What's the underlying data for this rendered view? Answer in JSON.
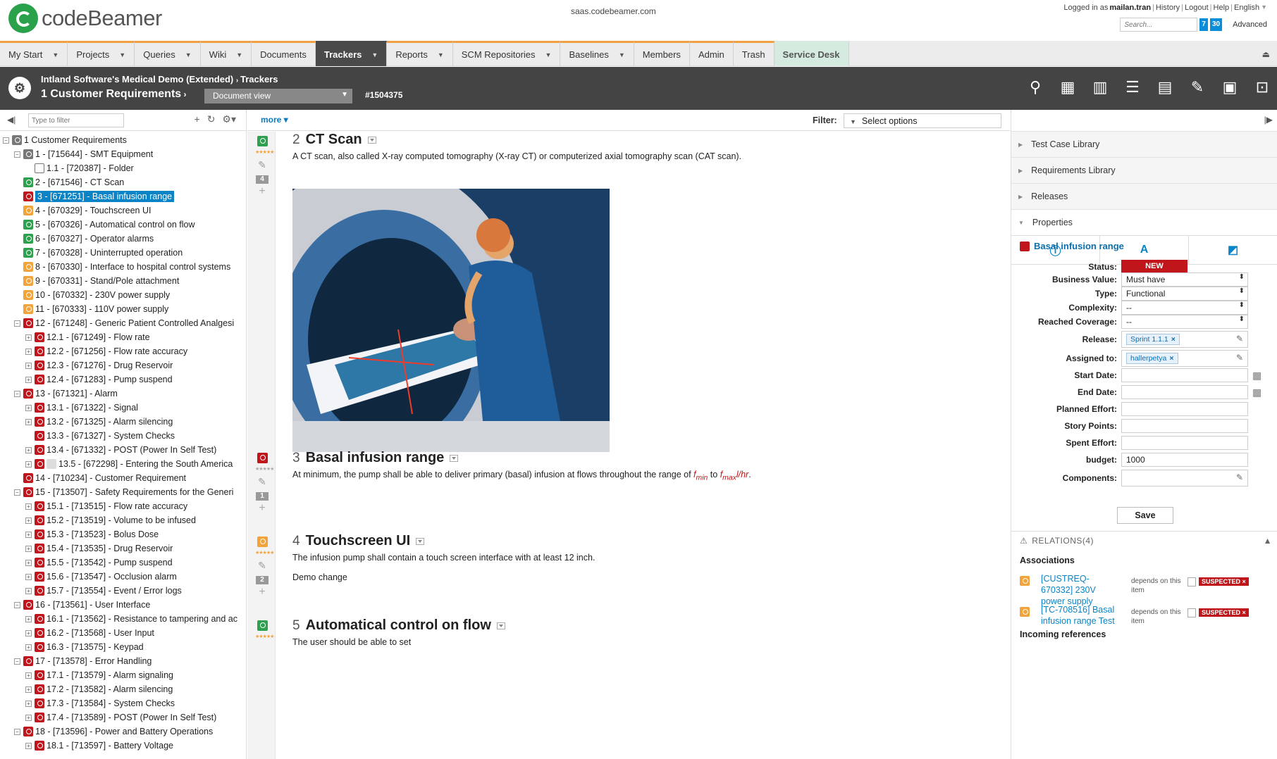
{
  "header": {
    "brand": "codeBeamer",
    "domain": "saas.codebeamer.com",
    "logged_in_prefix": "Logged in as",
    "username": "mailan.tran",
    "links": [
      "History",
      "Logout",
      "Help",
      "English"
    ],
    "search_placeholder": "Search...",
    "count_a": "7",
    "count_b": "30",
    "advanced": "Advanced"
  },
  "nav": {
    "tabs": [
      {
        "label": "My Start",
        "arrow": true
      },
      {
        "label": "Projects",
        "arrow": true
      },
      {
        "label": "Queries",
        "arrow": true
      },
      {
        "label": "Wiki",
        "arrow": true
      },
      {
        "label": "Documents",
        "arrow": false
      },
      {
        "label": "Trackers",
        "arrow": true,
        "active": true
      },
      {
        "label": "Reports",
        "arrow": true
      },
      {
        "label": "SCM Repositories",
        "arrow": true
      },
      {
        "label": "Baselines",
        "arrow": true
      },
      {
        "label": "Members",
        "arrow": false
      },
      {
        "label": "Admin",
        "arrow": false
      },
      {
        "label": "Trash",
        "arrow": false
      },
      {
        "label": "Service Desk",
        "arrow": false,
        "service": true
      }
    ]
  },
  "titlebar": {
    "project": "Intland Software's Medical Demo (Extended)",
    "section": "Trackers",
    "tracker": "1 Customer Requirements",
    "view": "Document view",
    "issue_id": "#1504375"
  },
  "left": {
    "filter_placeholder": "Type to filter",
    "tree": [
      {
        "level": 0,
        "exp": "-",
        "icon": "gray",
        "label": "1 Customer Requirements"
      },
      {
        "level": 1,
        "exp": "-",
        "icon": "gray",
        "label": "1 - [715644] - SMT Equipment"
      },
      {
        "level": 2,
        "exp": "",
        "icon": "folder",
        "label": "1.1 - [720387] - Folder"
      },
      {
        "level": 1,
        "exp": "",
        "icon": "green",
        "label": "2 - [671546] - CT Scan"
      },
      {
        "level": 1,
        "exp": "",
        "icon": "red",
        "label": "3 - [671251] - Basal infusion range",
        "selected": true
      },
      {
        "level": 1,
        "exp": "",
        "icon": "orange",
        "label": "4 - [670329] - Touchscreen UI"
      },
      {
        "level": 1,
        "exp": "",
        "icon": "green",
        "label": "5 - [670326] - Automatical control on flow"
      },
      {
        "level": 1,
        "exp": "",
        "icon": "green",
        "label": "6 - [670327] - Operator alarms"
      },
      {
        "level": 1,
        "exp": "",
        "icon": "green",
        "label": "7 - [670328] - Uninterrupted operation"
      },
      {
        "level": 1,
        "exp": "",
        "icon": "orange",
        "label": "8 - [670330] - Interface to hospital control systems"
      },
      {
        "level": 1,
        "exp": "",
        "icon": "orange",
        "label": "9 - [670331] - Stand/Pole attachment"
      },
      {
        "level": 1,
        "exp": "",
        "icon": "orange",
        "label": "10 - [670332] - 230V power supply"
      },
      {
        "level": 1,
        "exp": "",
        "icon": "orange",
        "label": "11 - [670333] - 110V power supply"
      },
      {
        "level": 1,
        "exp": "-",
        "icon": "red",
        "label": "12 - [671248] - Generic Patient Controlled Analgesi"
      },
      {
        "level": 2,
        "exp": "+",
        "icon": "red",
        "label": "12.1 - [671249] - Flow rate"
      },
      {
        "level": 2,
        "exp": "+",
        "icon": "red",
        "label": "12.2 - [671256] - Flow rate accuracy"
      },
      {
        "level": 2,
        "exp": "+",
        "icon": "red",
        "label": "12.3 - [671276] - Drug Reservoir"
      },
      {
        "level": 2,
        "exp": "+",
        "icon": "red",
        "label": "12.4 - [671283] - Pump suspend"
      },
      {
        "level": 1,
        "exp": "-",
        "icon": "red",
        "label": "13 - [671321] - Alarm"
      },
      {
        "level": 2,
        "exp": "+",
        "icon": "red",
        "label": "13.1 - [671322] - Signal"
      },
      {
        "level": 2,
        "exp": "+",
        "icon": "red",
        "label": "13.2 - [671325] - Alarm silencing"
      },
      {
        "level": 2,
        "exp": "",
        "icon": "red",
        "label": "13.3 - [671327] - System Checks"
      },
      {
        "level": 2,
        "exp": "+",
        "icon": "red",
        "label": "13.4 - [671332] - POST (Power In Self Test)"
      },
      {
        "level": 2,
        "exp": "+",
        "icon": "red",
        "icon2": "grey2",
        "label": "13.5 - [672298] - Entering the South America"
      },
      {
        "level": 1,
        "exp": "",
        "icon": "red",
        "label": "14 - [710234] - Customer Requirement"
      },
      {
        "level": 1,
        "exp": "-",
        "icon": "red",
        "label": "15 - [713507] - Safety Requirements for the Generi"
      },
      {
        "level": 2,
        "exp": "+",
        "icon": "red",
        "label": "15.1 - [713515] - Flow rate accuracy"
      },
      {
        "level": 2,
        "exp": "+",
        "icon": "red",
        "label": "15.2 - [713519] - Volume to be infused"
      },
      {
        "level": 2,
        "exp": "+",
        "icon": "red",
        "label": "15.3 - [713523] - Bolus Dose"
      },
      {
        "level": 2,
        "exp": "+",
        "icon": "red",
        "label": "15.4 - [713535] - Drug Reservoir"
      },
      {
        "level": 2,
        "exp": "+",
        "icon": "red",
        "label": "15.5 - [713542] - Pump suspend"
      },
      {
        "level": 2,
        "exp": "+",
        "icon": "red",
        "label": "15.6 - [713547] - Occlusion alarm"
      },
      {
        "level": 2,
        "exp": "+",
        "icon": "red",
        "label": "15.7 - [713554] - Event / Error logs"
      },
      {
        "level": 1,
        "exp": "-",
        "icon": "red",
        "label": "16 - [713561] - User Interface"
      },
      {
        "level": 2,
        "exp": "+",
        "icon": "red",
        "label": "16.1 - [713562] - Resistance to tampering and ac"
      },
      {
        "level": 2,
        "exp": "+",
        "icon": "red",
        "label": "16.2 - [713568] - User Input"
      },
      {
        "level": 2,
        "exp": "+",
        "icon": "red",
        "label": "16.3 - [713575] - Keypad"
      },
      {
        "level": 1,
        "exp": "-",
        "icon": "red",
        "label": "17 - [713578] - Error Handling"
      },
      {
        "level": 2,
        "exp": "+",
        "icon": "red",
        "label": "17.1 - [713579] - Alarm signaling"
      },
      {
        "level": 2,
        "exp": "+",
        "icon": "red",
        "label": "17.2 - [713582] - Alarm silencing"
      },
      {
        "level": 2,
        "exp": "+",
        "icon": "red",
        "label": "17.3 - [713584] - System Checks"
      },
      {
        "level": 2,
        "exp": "+",
        "icon": "red",
        "label": "17.4 - [713589] - POST (Power In Self Test)"
      },
      {
        "level": 1,
        "exp": "-",
        "icon": "red",
        "label": "18 - [713596] - Power and Battery Operations"
      },
      {
        "level": 2,
        "exp": "+",
        "icon": "red",
        "label": "18.1 - [713597] - Battery Voltage"
      }
    ]
  },
  "center": {
    "more": "more",
    "filter_label": "Filter:",
    "filter_value": "Select options",
    "gutter": [
      {
        "icon": "green",
        "stars": "★★★★★",
        "num": "4"
      },
      {
        "icon": "red",
        "stars": "★★★★★",
        "num": "1"
      },
      {
        "icon": "orange",
        "stars": "★★★★★",
        "num": "2"
      },
      {
        "icon": "green",
        "stars": "★★★★★",
        "num": ""
      }
    ],
    "sections": [
      {
        "num": "2",
        "title": "CT Scan",
        "text": "A CT scan, also called X-ray computed tomography (X-ray CT) or computerized axial tomography scan (CAT scan)."
      },
      {
        "num": "3",
        "title": "Basal infusion range",
        "text_pre": "At minimum, the pump shall be able to deliver primary (basal) infusion at flows throughout the range of ",
        "fmin": "f",
        "fmin_sub": "min",
        "to": " to ",
        "fmax": "f",
        "fmax_sub": "max",
        "unit": "l/hr",
        "end": "."
      },
      {
        "num": "4",
        "title": "Touchscreen UI",
        "text": "The infusion pump shall contain a touch screen interface with at least 12 inch.",
        "text2": "Demo change"
      },
      {
        "num": "5",
        "title": "Automatical control on flow",
        "text": "The user should be able to set"
      }
    ]
  },
  "right": {
    "accordions": [
      "Test Case Library",
      "Requirements Library",
      "Releases",
      "Properties"
    ],
    "item_title": "Basal infusion range",
    "props": {
      "status_label": "Status:",
      "status_value": "NEW",
      "bv_label": "Business Value:",
      "bv_value": "Must have",
      "type_label": "Type:",
      "type_value": "Functional",
      "complexity_label": "Complexity:",
      "complexity_value": "--",
      "coverage_label": "Reached Coverage:",
      "coverage_value": "--",
      "release_label": "Release:",
      "release_value": "Sprint 1.1.1",
      "assigned_label": "Assigned to:",
      "assigned_value": "hallerpetya",
      "start_label": "Start Date:",
      "end_label": "End Date:",
      "planned_label": "Planned Effort:",
      "story_label": "Story Points:",
      "spent_label": "Spent Effort:",
      "budget_label": "budget:",
      "budget_value": "1000",
      "components_label": "Components:"
    },
    "save": "Save",
    "relations_title": "RELATIONS(4)",
    "associations": "Associations",
    "relations": [
      {
        "icon": "orange",
        "title": "[CUSTREQ-670332] 230V power supply",
        "desc": "depends on this item",
        "badge": "SUSPECTED ×"
      },
      {
        "icon": "orange",
        "title": "[TC-708516] Basal infusion range Test",
        "desc": "depends on this item",
        "badge": "SUSPECTED ×"
      }
    ],
    "incoming": "Incoming references"
  },
  "colors": {
    "accent": "#0a84c6",
    "status_new": "#c0161b",
    "brand": "#2aa14b"
  }
}
